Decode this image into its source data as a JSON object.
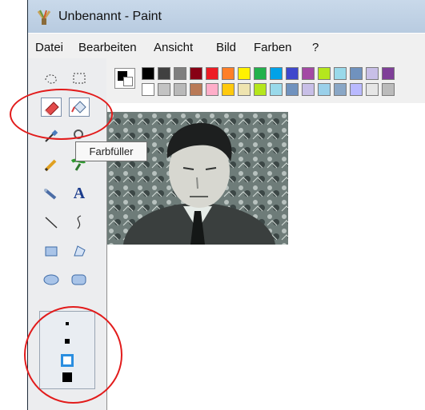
{
  "window": {
    "title": "Unbenannt - Paint"
  },
  "menubar": {
    "items": [
      "Datei",
      "Bearbeiten",
      "Ansicht",
      "Bild",
      "Farben",
      "?"
    ]
  },
  "toolbox": {
    "tools": [
      {
        "name": "free-select-icon"
      },
      {
        "name": "rect-select-icon"
      },
      {
        "name": "eraser-icon",
        "pressed": true
      },
      {
        "name": "fill-bucket-icon",
        "pressed": true
      },
      {
        "name": "color-picker-icon"
      },
      {
        "name": "magnifier-icon"
      },
      {
        "name": "pencil-icon"
      },
      {
        "name": "brush-icon"
      },
      {
        "name": "airbrush-icon"
      },
      {
        "name": "text-icon"
      },
      {
        "name": "line-icon"
      },
      {
        "name": "curve-icon"
      },
      {
        "name": "rectangle-icon"
      },
      {
        "name": "polygon-icon"
      },
      {
        "name": "ellipse-icon"
      },
      {
        "name": "rounded-rect-icon"
      }
    ],
    "text_tool_label": "A"
  },
  "tooltip": {
    "text": "Farbfüller"
  },
  "palette": {
    "row1": [
      "#000000",
      "#404040",
      "#7f7f7f",
      "#880015",
      "#ed1c24",
      "#ff7f27",
      "#fff200",
      "#22b14c",
      "#00a2e8",
      "#3f48cc",
      "#a349a4",
      "#b5e61d",
      "#99d9ea",
      "#7092be",
      "#c8bfe7",
      "#7f3f98"
    ],
    "row2": [
      "#ffffff",
      "#c3c3c3",
      "#b9b9b9",
      "#b97a57",
      "#ffaec9",
      "#ffc90e",
      "#efe4b0",
      "#b5e61d",
      "#99d9ea",
      "#7092be",
      "#c8bfe7",
      "#9ad0ea",
      "#8aa7c6",
      "#b9b9ff",
      "#e6e6e6",
      "#bbbbbb"
    ],
    "foreground": "#000000",
    "background": "#ffffff"
  },
  "colors": {
    "annotation_circle": "#e21b1b",
    "frame_blue": "#b8cbe0"
  }
}
